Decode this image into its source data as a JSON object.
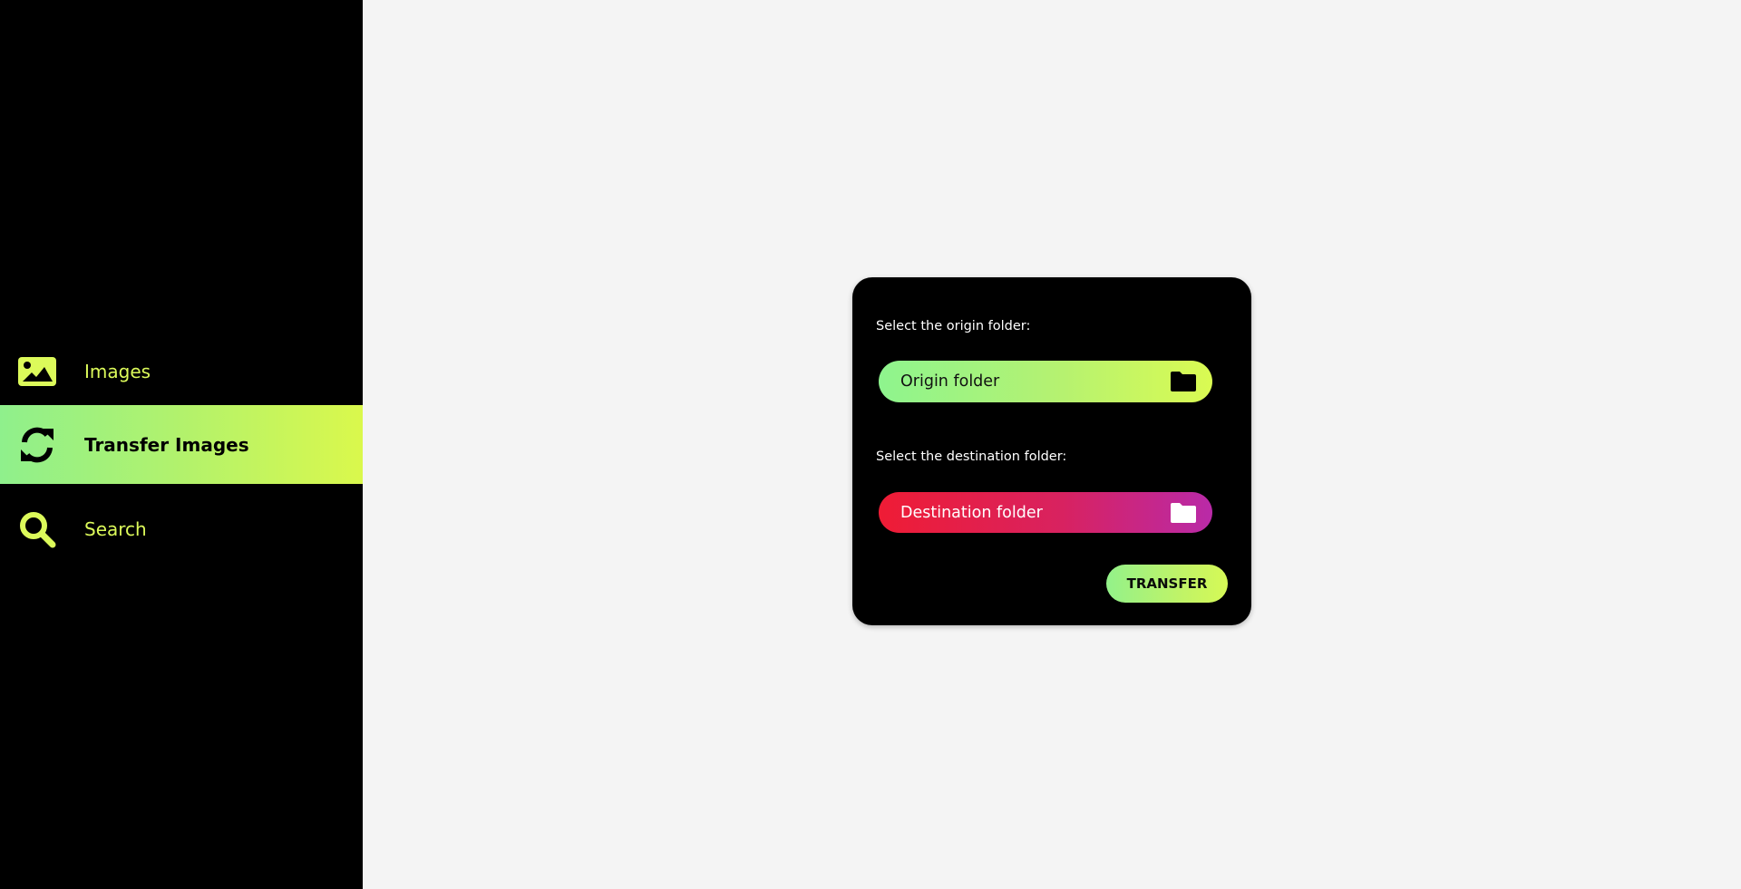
{
  "sidebar": {
    "items": [
      {
        "label": "Images",
        "icon": "image-icon",
        "active": false
      },
      {
        "label": "Transfer Images",
        "icon": "refresh-icon",
        "active": true
      },
      {
        "label": "Search",
        "icon": "search-icon",
        "active": false
      }
    ]
  },
  "panel": {
    "origin_label": "Select the origin folder:",
    "origin_placeholder": "Origin folder",
    "destination_label": "Select the destination folder:",
    "destination_placeholder": "Destination folder",
    "transfer_label": "TRANSFER"
  },
  "colors": {
    "sidebar_bg": "#000000",
    "accent_text": "#dcfa5a",
    "accent_gradient_start": "#8ff08c",
    "accent_gradient_end": "#daf84c",
    "destination_gradient_start": "#ef1c35",
    "destination_gradient_end": "#b92aa8",
    "page_bg": "#f4f4f4"
  }
}
